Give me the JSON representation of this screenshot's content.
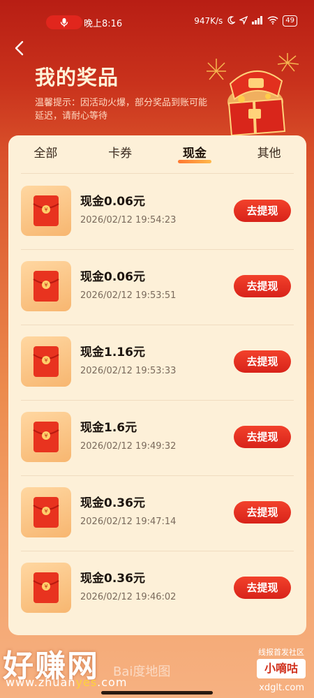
{
  "status_bar": {
    "time": "晚上8:16",
    "network_speed": "947K/s",
    "battery": "49",
    "icons": [
      "mic-icon",
      "moon-icon",
      "location-icon",
      "signal-icon",
      "wifi-icon",
      "battery-icon"
    ]
  },
  "header": {
    "back_icon": "chevron-left-icon",
    "title": "我的奖品",
    "tip": "温馨提示：因活动火爆，部分奖品到账可能延迟，请耐心等待",
    "illustration": "treasure-chest-icon"
  },
  "tabs": [
    {
      "label": "全部",
      "active": false
    },
    {
      "label": "卡券",
      "active": false
    },
    {
      "label": "现金",
      "active": true
    },
    {
      "label": "其他",
      "active": false
    }
  ],
  "prizes": [
    {
      "amount": "现金0.06元",
      "time": "2026/02/12 19:54:23",
      "button": "去提现"
    },
    {
      "amount": "现金0.06元",
      "time": "2026/02/12 19:53:51",
      "button": "去提现"
    },
    {
      "amount": "现金1.16元",
      "time": "2026/02/12 19:53:33",
      "button": "去提现"
    },
    {
      "amount": "现金1.6元",
      "time": "2026/02/12 19:49:32",
      "button": "去提现"
    },
    {
      "amount": "现金0.36元",
      "time": "2026/02/12 19:47:14",
      "button": "去提现"
    },
    {
      "amount": "现金0.36元",
      "time": "2026/02/12 19:46:02",
      "button": "去提现"
    }
  ],
  "watermarks": {
    "left_big": "好赚网",
    "left_url_a": "www.zhuan",
    "left_url_b": "yes",
    "left_url_c": ".com",
    "baidu": "Bai度地图",
    "right_small": "线报首发社区",
    "right_box": "小嘀咕",
    "right_url": "xdglt.com"
  },
  "colors": {
    "accent": "#e1261d",
    "card_bg": "#fdf0d8",
    "button": "#e0301f"
  }
}
